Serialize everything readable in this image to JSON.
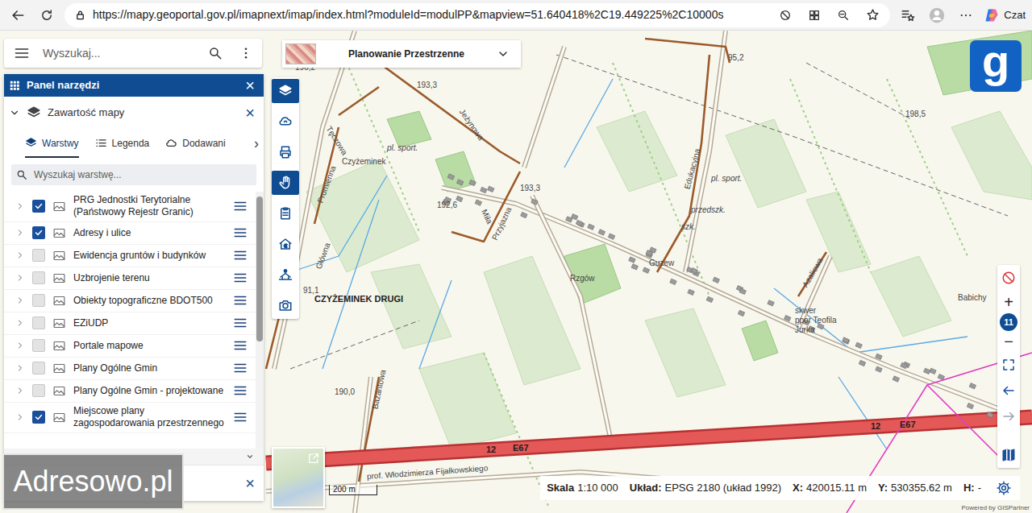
{
  "browser": {
    "url": "https://mapy.geoportal.gov.pl/imapnext/imap/index.html?moduleId=modulPP&mapview=51.640418%2C19.449225%2C10000s",
    "chat": "Czat"
  },
  "search": {
    "placeholder": "Wyszukaj..."
  },
  "tool_panel": {
    "title": "Panel narzędzi",
    "close": "×"
  },
  "map_contents": {
    "title": "Zawartość mapy",
    "expanded": true,
    "close": "×"
  },
  "tabs": [
    {
      "label": "Warstwy",
      "selected": true
    },
    {
      "label": "Legenda",
      "selected": false
    },
    {
      "label": "Dodawani",
      "selected": false
    }
  ],
  "tabs_more": "›",
  "layer_search": {
    "placeholder": "Wyszukaj warstwę..."
  },
  "layers": [
    {
      "name": "PRG Jednostki Terytorialne (Państwowy Rejestr Granic)",
      "checked": true
    },
    {
      "name": "Adresy i ulice",
      "checked": true
    },
    {
      "name": "Ewidencja gruntów i budynków",
      "checked": false
    },
    {
      "name": "Uzbrojenie terenu",
      "checked": false
    },
    {
      "name": "Obiekty topograficzne BDOT500",
      "checked": false
    },
    {
      "name": "EZiUDP",
      "checked": false
    },
    {
      "name": "Portale mapowe",
      "checked": false
    },
    {
      "name": "Plany Ogólne Gmin",
      "checked": false
    },
    {
      "name": "Plany Ogólne Gmin - projektowane",
      "checked": false
    },
    {
      "name": "Miejscowe plany zagospodarowania przestrzennego",
      "checked": true
    }
  ],
  "bottom_panel": {
    "close": "×"
  },
  "watermark": "Adresowo.pl",
  "module": {
    "label": "Planowanie Przestrzenne"
  },
  "logo": "g",
  "map_tools": [
    {
      "kind": "layers",
      "selected": true
    },
    {
      "kind": "cloud",
      "selected": false
    },
    {
      "kind": "print",
      "selected": false
    },
    {
      "kind": "hand",
      "selected": true
    },
    {
      "kind": "clipboard",
      "selected": false
    },
    {
      "kind": "price",
      "selected": false
    },
    {
      "kind": "light",
      "selected": false
    },
    {
      "kind": "camera",
      "selected": false
    }
  ],
  "map": {
    "labels": [
      "196,2",
      "193,3",
      "95,2",
      "198,5",
      "Jeżynowa",
      "Tęczowa",
      "Promienna",
      "pl. sport.",
      "Czyżeminek",
      "192,6",
      "Miła",
      "Przyjazna",
      "193,3",
      "Edukacyjna",
      "pl. sport.",
      "przedszk.",
      "szk.",
      "Guzew",
      "Rzgów",
      "91,1",
      "CZYŻEMINEK DRUGI",
      "Główna",
      "Azaliowa",
      "skwer",
      "ppor Teofila",
      "Jurka",
      "Babichy",
      "190,0",
      "Bażantowa",
      "prof. Włodzimierza Fijałkowskiego"
    ],
    "shields": [
      "12",
      "E67",
      "12",
      "E67"
    ]
  },
  "zoom": {
    "plus": "+",
    "level": "11",
    "minus": "−"
  },
  "scale_bar": "200 m",
  "status_bar": {
    "scale_label": "Skala",
    "scale": "1:10 000",
    "crs_label": "Układ:",
    "crs": "EPSG 2180 (układ 1992)",
    "x_label": "X:",
    "x": "420015.11 m",
    "y_label": "Y:",
    "y": "530355.62 m",
    "h_label": "H:",
    "h": "-"
  },
  "powered": "Powered by GISPartner"
}
